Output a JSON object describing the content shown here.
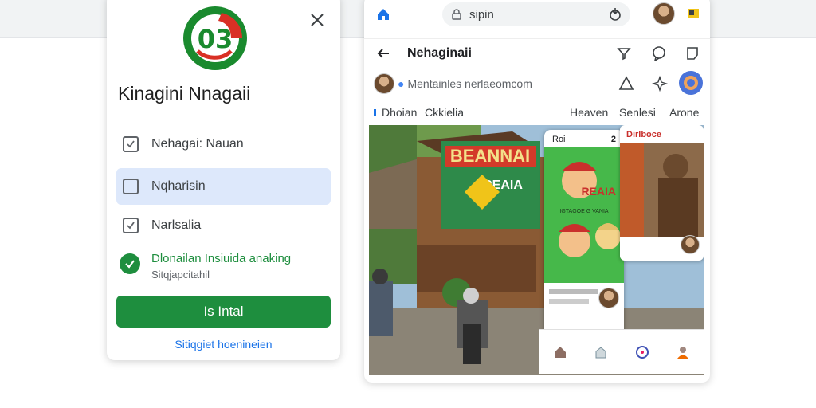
{
  "dialog": {
    "title": "Kinagini Nnagaii",
    "options": [
      {
        "label": "Nehagai: Nauan"
      },
      {
        "label": "Nqharisin"
      },
      {
        "label": "Narlsalia"
      }
    ],
    "status_main": "Dlonailan Insiuida anaking",
    "status_sub": "Sitqjapcitahil",
    "install_label": "Is Intal",
    "link_text": "Sitiqgiet hoenineien"
  },
  "browser": {
    "address": "sipin",
    "page_title": "Nehaginaii",
    "account": "Mentainles nerlaeomcom",
    "tabs": [
      "Dhoian",
      "Ckkielia",
      "Heaven",
      "Senlesi",
      "Arone"
    ],
    "phone": {
      "header_left": "Roi",
      "header_right": "2",
      "banner_text": "REAIA",
      "banner_sub": "IGTAGOE G  VANIA"
    },
    "card_title": "Dirlboce",
    "sign_text": "BEANNAI",
    "sign_sub": "REAIA"
  },
  "colors": {
    "accent_green": "#1e8e3e",
    "accent_blue": "#1a73e8",
    "selected_bg": "#dde8fb",
    "logo_green": "#1a8a2e",
    "logo_red": "#d93025"
  },
  "icons": {
    "close": "close-icon",
    "home": "home-icon",
    "lock": "lock-icon",
    "back": "back-arrow-icon"
  }
}
